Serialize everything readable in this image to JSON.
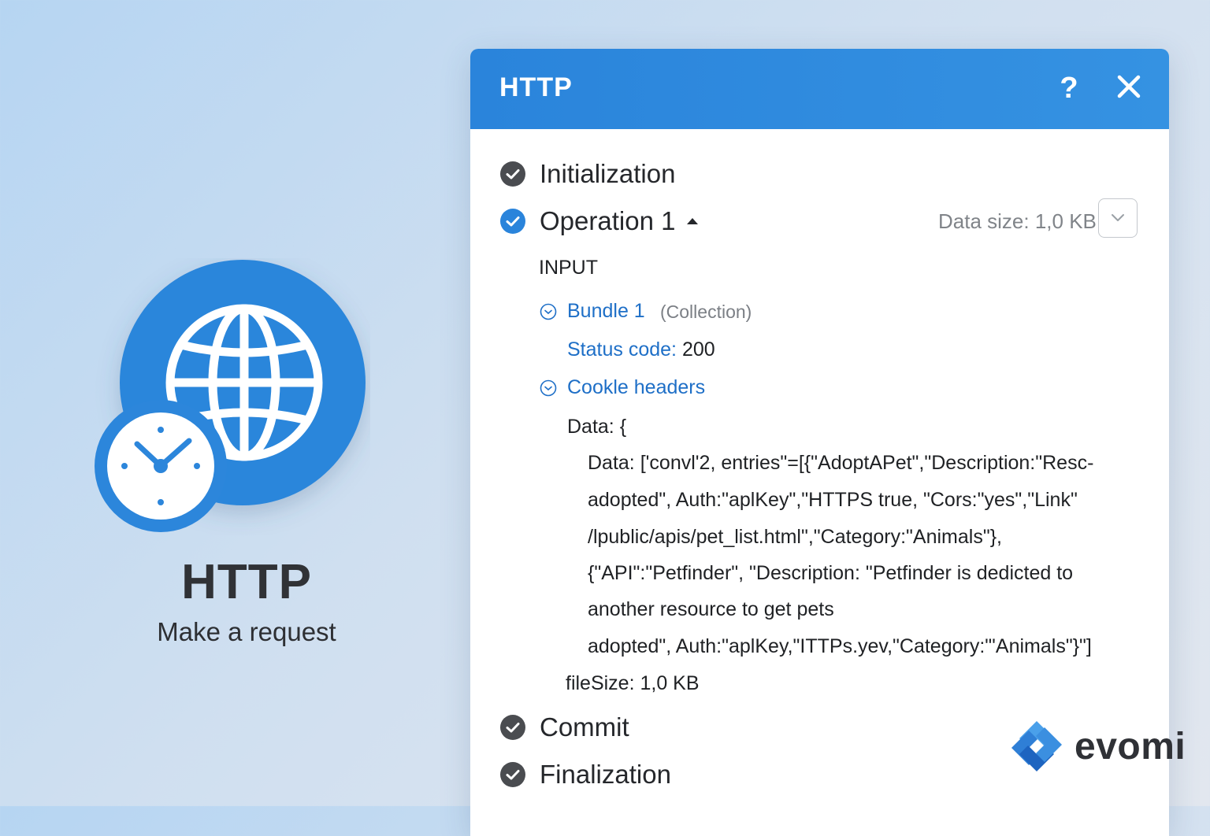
{
  "app": {
    "name": "HTTP",
    "subtitle": "Make a request"
  },
  "panel": {
    "title": "HTTP",
    "help_label": "?",
    "steps": {
      "initialization": "Initialization",
      "operation": "Operation 1",
      "commit": "Commit",
      "finalization": "Finalization"
    },
    "data_size": "Data size: 1,0 KB",
    "input_label": "INPUT",
    "bundle": {
      "label": "Bundle 1",
      "type": "(Collection)"
    },
    "status_code": {
      "key": "Status code:",
      "value": "200"
    },
    "cookie_headers": "Cookle headers",
    "data_open": "Data:  {",
    "data_lines": [
      "Data:  ['convl'2, entries\"=[{\"AdoptAPet\",\"Description:\"Resc-",
      "adopted\", Auth:\"aplKey\",\"HTTPS true, \"Cors:\"yes\",\"Link\"",
      "/lpublic/apis/pet_list.html\",\"Category:\"Animals\"},",
      "{\"API\":\"Petfinder\", \"Description: \"Petfinder is dedicted to",
      "another resource to get pets",
      "adopted\", Auth:\"aplKey,\"ITTPs.yev,\"Category:\"'Animals\"}\"]"
    ],
    "file_size": "fileSize: 1,0 KB"
  },
  "watermark": {
    "brand": "evomi"
  },
  "colors": {
    "accent": "#2a84db",
    "link": "#1e6fc7",
    "done": "#4a4c50"
  }
}
